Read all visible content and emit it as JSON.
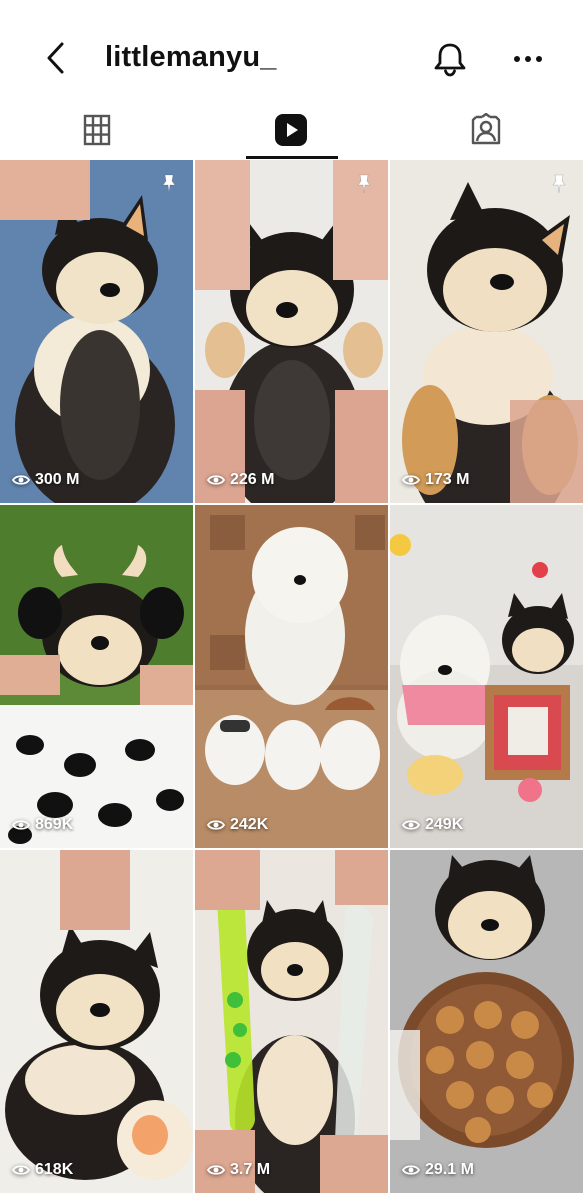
{
  "header": {
    "username": "littlemanyu_",
    "icons": [
      "back-arrow-icon",
      "bell-icon",
      "more-icon"
    ]
  },
  "tabs": [
    {
      "name": "grid",
      "icon": "grid-icon",
      "active": false
    },
    {
      "name": "reels",
      "icon": "reels-icon",
      "active": true
    },
    {
      "name": "tagged",
      "icon": "tagged-icon",
      "active": false
    }
  ],
  "reels": [
    {
      "views": "300 M",
      "pinned": true
    },
    {
      "views": "226 M",
      "pinned": true
    },
    {
      "views": "173 M",
      "pinned": true
    },
    {
      "views": "869K",
      "pinned": false
    },
    {
      "views": "242K",
      "pinned": false
    },
    {
      "views": "249K",
      "pinned": false
    },
    {
      "views": "618K",
      "pinned": false
    },
    {
      "views": "3.7 M",
      "pinned": false
    },
    {
      "views": "29.1 M",
      "pinned": false
    }
  ],
  "colors": {
    "text": "#111111",
    "underline": "#111111",
    "views_text": "#ffffff"
  }
}
